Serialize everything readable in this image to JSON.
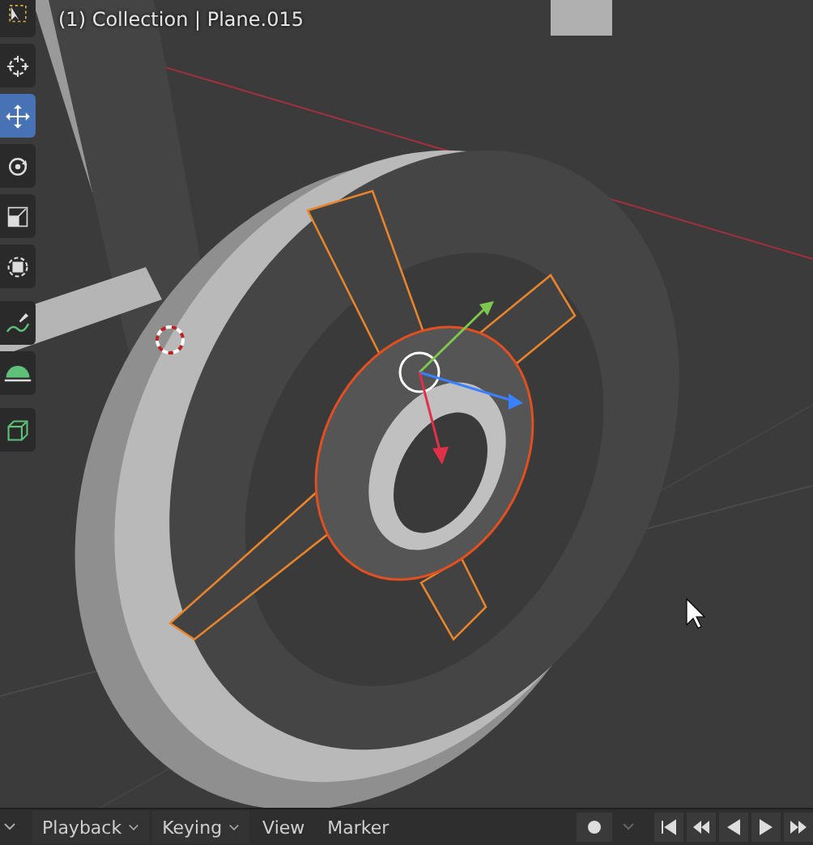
{
  "viewport": {
    "overlay_text": "(1) Collection | Plane.015"
  },
  "toolbar": {
    "tools": [
      {
        "kind": "select",
        "selected": false
      },
      {
        "kind": "cursor",
        "selected": false
      },
      {
        "kind": "move",
        "selected": true
      },
      {
        "kind": "rotate",
        "selected": false
      },
      {
        "kind": "scale",
        "selected": false
      },
      {
        "kind": "transform",
        "selected": false
      },
      {
        "kind": "annotate",
        "selected": false
      },
      {
        "kind": "measure",
        "selected": false
      },
      {
        "kind": "cube",
        "selected": false
      }
    ]
  },
  "timeline": {
    "menus": [
      {
        "label": "Playback",
        "dropdown": true
      },
      {
        "label": "Keying",
        "dropdown": true
      },
      {
        "label": "View",
        "dropdown": false
      },
      {
        "label": "Marker",
        "dropdown": false
      }
    ]
  }
}
